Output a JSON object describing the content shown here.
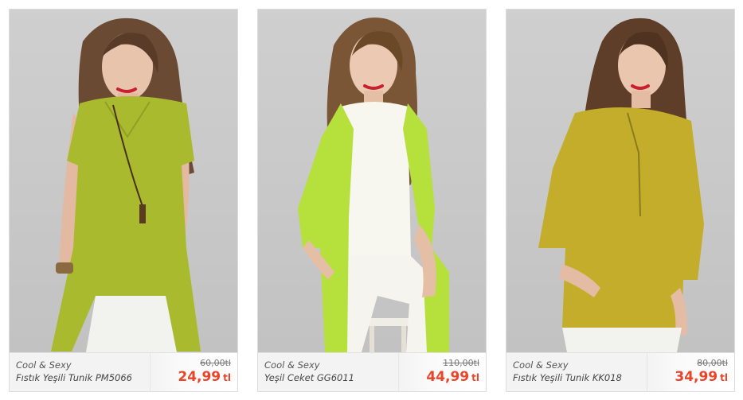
{
  "colors": {
    "price": "#e8452b",
    "card_border": "#dcdcdc",
    "info_bg": "#f3f3f3",
    "photo_bg": "#c8c8c8"
  },
  "products": [
    {
      "brand": "Cool & Sexy",
      "name": "Fıstık Yeşili Tunik PM5066",
      "old_price": "60,00tl",
      "price": "24,99",
      "currency": "tl",
      "garment_color": "#a9ba2f",
      "image_alt": "Fıstık Yeşili Tunik PM5066"
    },
    {
      "brand": "Cool & Sexy",
      "name": "Yeşil Ceket GG6011",
      "old_price": "110,00tl",
      "price": "44,99",
      "currency": "tl",
      "garment_color": "#b6e03c",
      "image_alt": "Yeşil Ceket GG6011"
    },
    {
      "brand": "Cool & Sexy",
      "name": "Fıstık Yeşili Tunik KK018",
      "old_price": "80,00tl",
      "price": "34,99",
      "currency": "tl",
      "garment_color": "#c4ad2a",
      "image_alt": "Fıstık Yeşili Tunik KK018"
    }
  ]
}
